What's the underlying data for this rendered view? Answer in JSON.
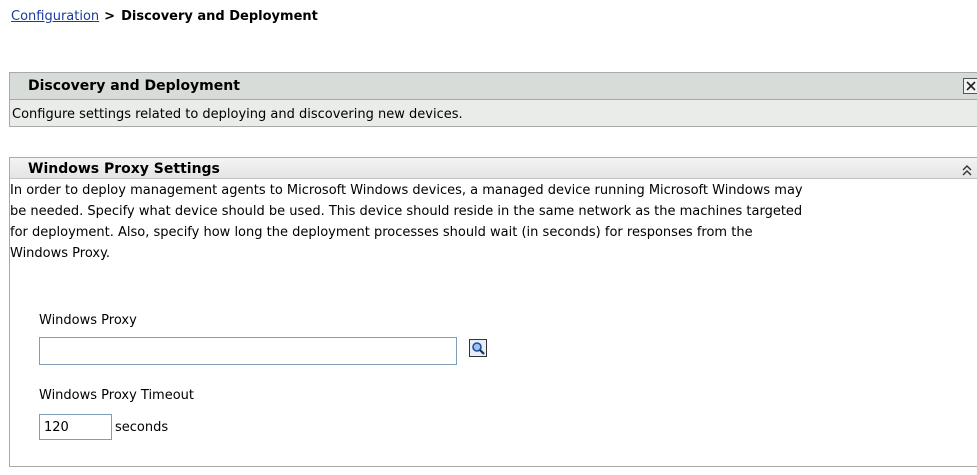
{
  "breadcrumb": {
    "parent": "Configuration",
    "separator": ">",
    "current": "Discovery and Deployment"
  },
  "info_panel": {
    "title": "Discovery and Deployment",
    "description": "Configure settings related to deploying and discovering new devices."
  },
  "settings_panel": {
    "title": "Windows Proxy Settings",
    "description": "In order to deploy management agents to Microsoft Windows devices, a managed device running Microsoft Windows may\nbe needed. Specify what device should be used. This device should reside in the same network as the machines targeted\nfor deployment. Also, specify how long the deployment processes should wait (in seconds) for responses from the\nWindows Proxy.",
    "proxy": {
      "label": "Windows Proxy",
      "value": ""
    },
    "timeout": {
      "label": "Windows Proxy Timeout",
      "value": "120",
      "unit": "seconds"
    }
  },
  "colors": {
    "link": "#1a3c9c",
    "info_bg": "#e9ece9",
    "info_header_bg": "#d8dcd8",
    "border": "#a9a9a9",
    "input_border": "#7f9db9"
  },
  "icons": {
    "close": "close-icon",
    "collapse": "double-chevron-up-icon",
    "browse": "magnifier-icon"
  }
}
